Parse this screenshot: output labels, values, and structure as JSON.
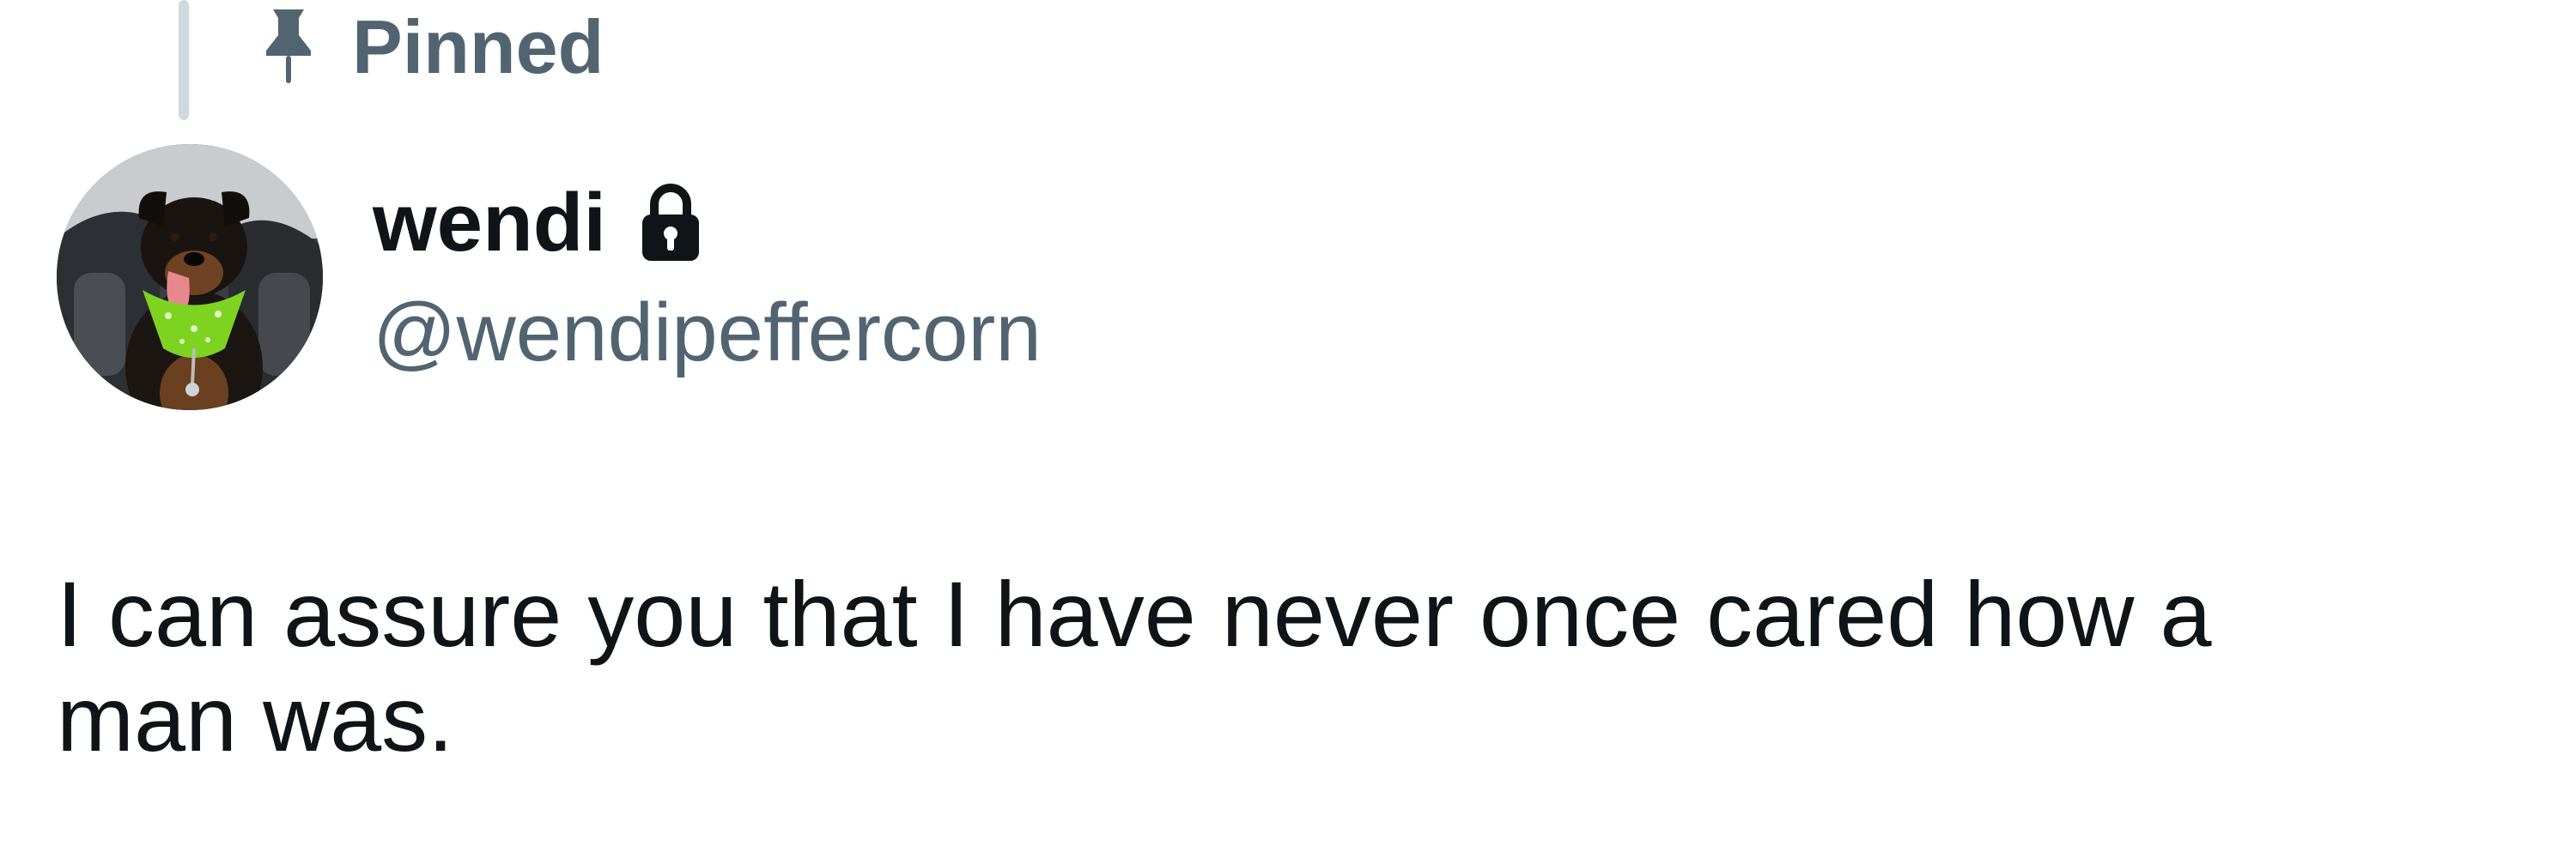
{
  "pinned": {
    "label": "Pinned",
    "icon": "pin-icon"
  },
  "author": {
    "display_name": "wendi",
    "handle": "@wendipeffercorn",
    "protected_icon": "lock-icon",
    "avatar_icon": "dog-avatar"
  },
  "tweet": {
    "text": "I can assure you that I have never once cared how a\nman was."
  },
  "colors": {
    "primary_text": "#0f1419",
    "secondary_text": "#536471",
    "thread_line": "#cfd9de"
  }
}
